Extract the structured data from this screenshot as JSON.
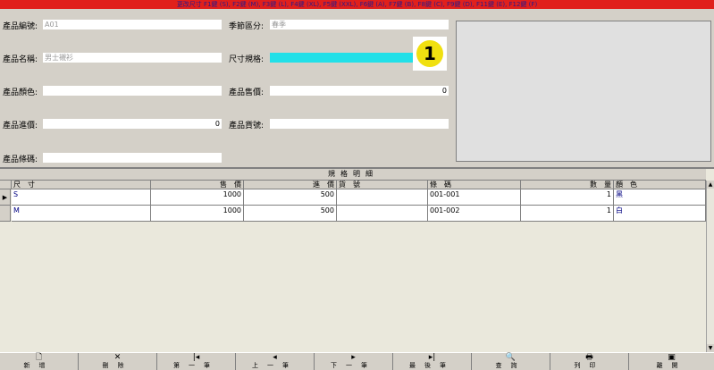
{
  "topbar": {
    "text": "更改尺寸 F1鍵 (S), F2鍵 (M), F3鍵 (L), F4鍵 (XL), F5鍵 (XXL), F6鍵 (A), F7鍵 (B), F8鍵 (C), F9鍵 (D), F11鍵 (E), F12鍵 (F)"
  },
  "form": {
    "product_code_label": "產品編號:",
    "product_code_value": "A01",
    "season_label": "季節區分:",
    "season_value": "春季",
    "product_name_label": "產品名稱:",
    "product_name_value": "男士襯衫",
    "size_spec_label": "尺寸規格:",
    "size_spec_value": "",
    "color_label": "產品顏色:",
    "color_value": "",
    "sale_price_label": "產品售價:",
    "sale_price_value": "0",
    "cost_price_label": "產品進價:",
    "cost_price_value": "0",
    "product_sku_label": "產品貨號:",
    "product_sku_value": "",
    "barcode_label": "產品條碼:",
    "barcode_value": ""
  },
  "badge": {
    "number": "1"
  },
  "grid": {
    "title": "規格明細",
    "columns": [
      "尺　寸",
      "售　價",
      "進　價",
      "貨　號",
      "條　碼",
      "數　量",
      "顏　色"
    ],
    "rows": [
      {
        "marker": "▶",
        "size": "S",
        "price": "1000",
        "cost": "500",
        "sku": "",
        "barcode": "001-001",
        "qty": "1",
        "color": "黑"
      },
      {
        "marker": "",
        "size": "M",
        "price": "1000",
        "cost": "500",
        "sku": "",
        "barcode": "001-002",
        "qty": "1",
        "color": "白"
      }
    ]
  },
  "toolbar": {
    "buttons": [
      {
        "icon": "new-doc-icon",
        "glyph": "🗋",
        "label": "新增"
      },
      {
        "icon": "delete-icon",
        "glyph": "✕",
        "label": "刪除"
      },
      {
        "icon": "first-record-icon",
        "glyph": "|◂",
        "label": "第一筆"
      },
      {
        "icon": "prev-record-icon",
        "glyph": "◂",
        "label": "上一筆"
      },
      {
        "icon": "next-record-icon",
        "glyph": "▸",
        "label": "下一筆"
      },
      {
        "icon": "last-record-icon",
        "glyph": "▸|",
        "label": "最後筆"
      },
      {
        "icon": "search-icon",
        "glyph": "🔍",
        "label": "查詢"
      },
      {
        "icon": "print-icon",
        "glyph": "🖶",
        "label": "列印"
      },
      {
        "icon": "exit-icon",
        "glyph": "▣",
        "label": "離開"
      }
    ]
  }
}
